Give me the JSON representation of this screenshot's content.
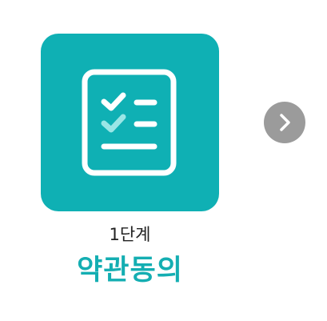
{
  "step": {
    "icon": "checklist-document-icon",
    "number_label": "1단계",
    "title": "약관동의",
    "card_color": "#0fb0b4",
    "title_color": "#14aeb2"
  },
  "next_button": {
    "icon": "chevron-right-icon",
    "color": "#9b9b9b"
  }
}
